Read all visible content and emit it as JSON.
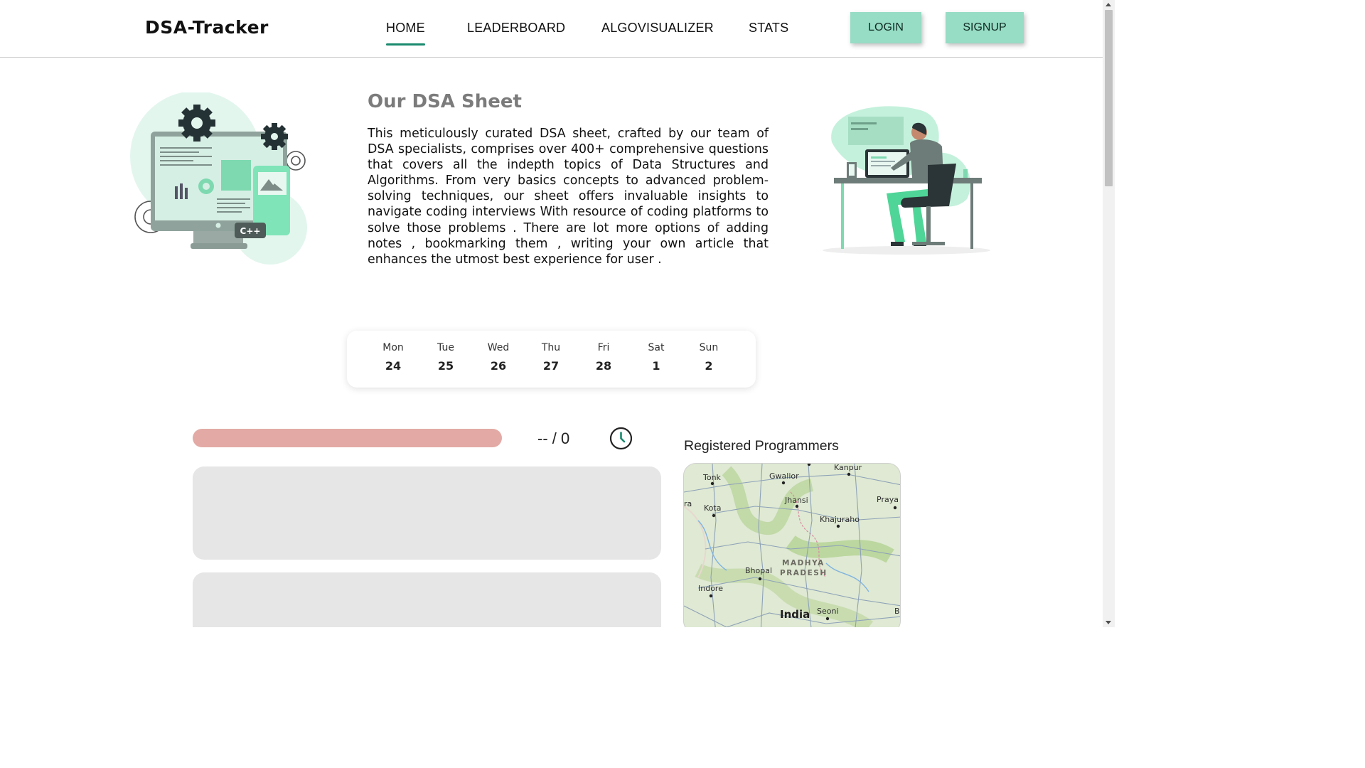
{
  "brand": {
    "name": "DSA-Tracker"
  },
  "nav": {
    "links": [
      {
        "label": "HOME",
        "active": true
      },
      {
        "label": "LEADERBOARD",
        "active": false
      },
      {
        "label": "ALGOVISUALIZER",
        "active": false
      },
      {
        "label": "STATS",
        "active": false
      }
    ],
    "login_label": "LOGIN",
    "signup_label": "SIGNUP",
    "button_color": "#97dcc5",
    "accent_color": "#1a8a6e"
  },
  "hero": {
    "title": "Our DSA Sheet",
    "description": "This meticulously curated DSA sheet, crafted by our team of DSA specialists, comprises over 400+ comprehensive questions that covers all the indepth topics of Data Structures and Algorithms. From very basics concepts to advanced problem-solving techniques, our sheet offers invaluable insights to navigate coding interviews With resource of coding platforms to solve those problems . There are lot more options of adding notes , bookmarking them , writing your own article that enhances the utmost best experience for user .",
    "illustration_left": {
      "icon": "computer-gears-illustration",
      "badge": "C++"
    },
    "illustration_right": {
      "icon": "person-at-desk-illustration"
    }
  },
  "calendar": {
    "days": [
      {
        "name": "Mon",
        "date": "24"
      },
      {
        "name": "Tue",
        "date": "25"
      },
      {
        "name": "Wed",
        "date": "26"
      },
      {
        "name": "Thu",
        "date": "27"
      },
      {
        "name": "Fri",
        "date": "28"
      },
      {
        "name": "Sat",
        "date": "1"
      },
      {
        "name": "Sun",
        "date": "2"
      }
    ]
  },
  "progress": {
    "solved": "--",
    "total": "0",
    "count_text": "-- / 0",
    "fraction": 0,
    "track_color": "#e3aaa5",
    "icon": "clock-icon"
  },
  "registered": {
    "title": "Registered Programmers",
    "map": {
      "cities": [
        "Tonk",
        "Gwalior",
        "Kanpur",
        "Kota",
        "Jhansi",
        "Praya",
        "Khajuraho",
        "Bhopal",
        "Indore",
        "Seoni",
        "ra",
        "B"
      ],
      "region": [
        "MADHYA",
        "PRADESH"
      ],
      "country": "India"
    }
  }
}
